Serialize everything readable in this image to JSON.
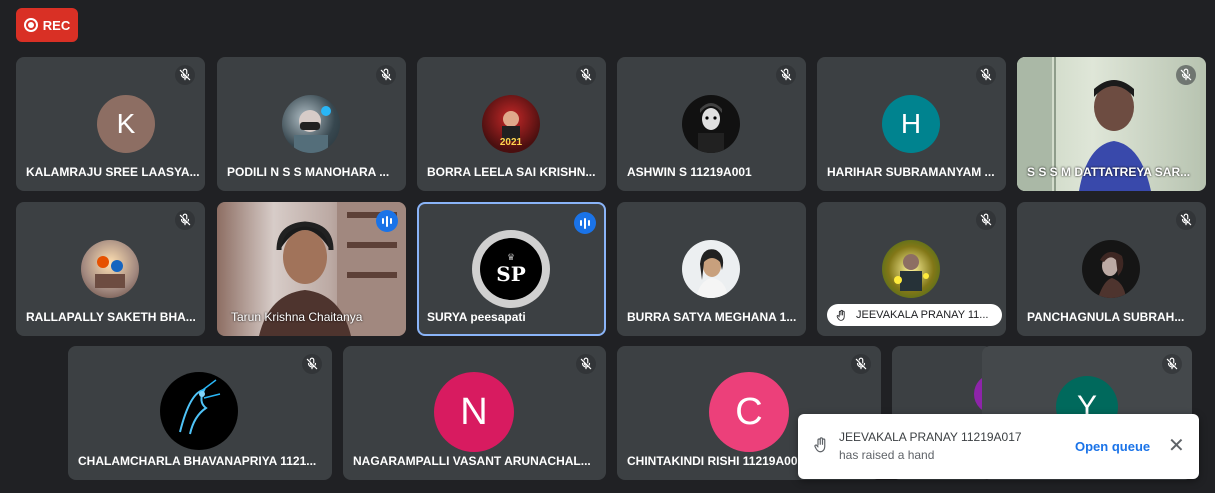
{
  "rec_label": "REC",
  "tiles": {
    "t1": {
      "name": "KALAMRAJU SREE LAASYA...",
      "initial": "K",
      "color": "#8d6e63"
    },
    "t2": {
      "name": "PODILI N S S MANOHARA ..."
    },
    "t3": {
      "name": "BORRA LEELA SAI KRISHN...",
      "avatar_text": "2021"
    },
    "t4": {
      "name": "ASHWIN S 11219A001"
    },
    "t5": {
      "name": "HARIHAR SUBRAMANYAM ...",
      "initial": "H",
      "color": "#00838f"
    },
    "t6": {
      "name": "S S S M DATTATREYA SAR..."
    },
    "t7": {
      "name": "RALLAPALLY SAKETH BHA..."
    },
    "t8": {
      "name": "Tarun Krishna Chaitanya"
    },
    "t9": {
      "name": "SURYA peesapati",
      "avatar_text": "SP"
    },
    "t10": {
      "name": "BURRA SATYA MEGHANA 1..."
    },
    "t11": {
      "name": "JEEVAKALA PRANAY 11..."
    },
    "t12": {
      "name": "PANCHAGNULA SUBRAH..."
    },
    "t13": {
      "name": "CHALAMCHARLA BHAVANAPRIYA 1121..."
    },
    "t14": {
      "name": "NAGARAMPALLI VASANT ARUNACHAL...",
      "initial": "N",
      "color": "#d81b60"
    },
    "t15": {
      "name": "CHINTAKINDI RISHI 11219A00",
      "initial": "C",
      "color": "#ec407a"
    },
    "t16": {
      "initial": "Y",
      "color": "#00695c"
    }
  },
  "toast": {
    "title": "JEEVAKALA PRANAY 11219A017",
    "message": "has raised a hand",
    "action": "Open queue",
    "close": "✕"
  },
  "icons": {
    "mic_off": "mic-off-icon",
    "speaking": "speaking-indicator-icon",
    "hand": "raised-hand-icon",
    "record": "record-icon",
    "close": "close-icon"
  },
  "colors": {
    "background": "#202124",
    "tile": "#3c4043",
    "rec": "#d93025",
    "speaking": "#1a73e8",
    "active_border": "#8ab4f8"
  }
}
